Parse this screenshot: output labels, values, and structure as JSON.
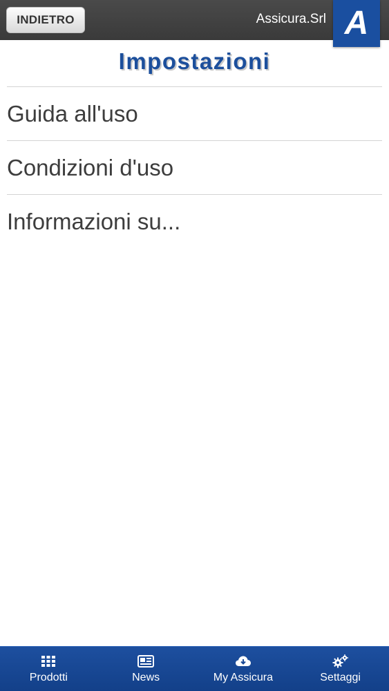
{
  "header": {
    "back_label": "INDIETRO",
    "brand_name": "Assicura.Srl",
    "logo_letter": "A"
  },
  "page": {
    "title": "Impostazioni"
  },
  "menu": {
    "items": [
      {
        "label": "Guida all'uso"
      },
      {
        "label": "Condizioni d'uso"
      },
      {
        "label": "Informazioni su..."
      }
    ]
  },
  "tabbar": {
    "tabs": [
      {
        "label": "Prodotti",
        "icon": "grid-icon"
      },
      {
        "label": "News",
        "icon": "newspaper-icon"
      },
      {
        "label": "My Assicura",
        "icon": "cloud-download-icon"
      },
      {
        "label": "Settaggi",
        "icon": "gears-icon"
      }
    ]
  },
  "colors": {
    "accent": "#1c4f9c",
    "topbar": "#404040",
    "tabbar": "#1a4a97"
  }
}
